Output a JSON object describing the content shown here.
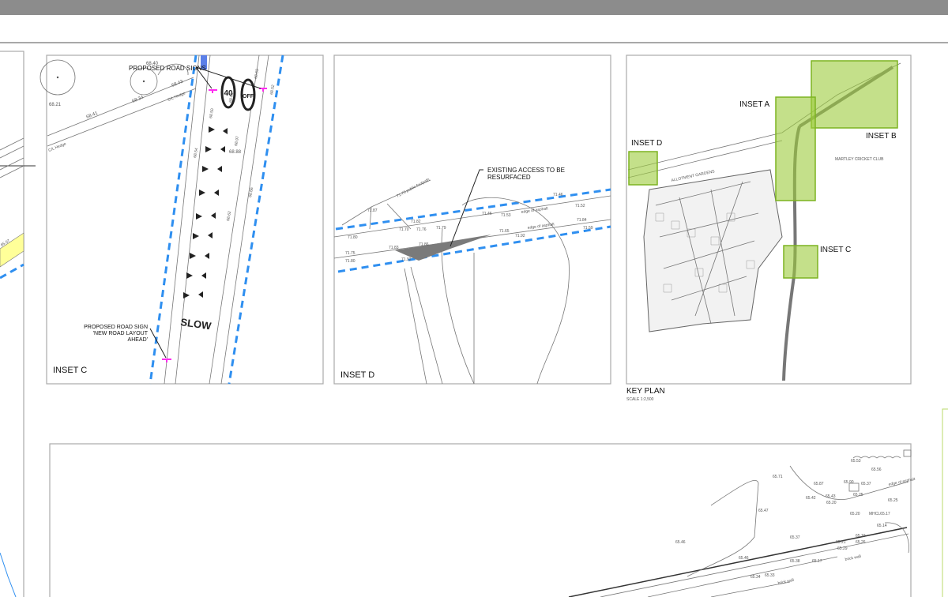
{
  "inset_c": {
    "title": "INSET C",
    "callout_signs": "PROPOSED ROAD SIGNS",
    "callout_sign_1": "PROPOSED ROAD SIGN",
    "callout_sign_2": "'NEW ROAD LAYOUT",
    "callout_sign_3": "AHEAD'",
    "sign_40": "40",
    "sign_derestrict": "OFF",
    "road_marking": "SLOW",
    "hedge_1": "C/L Hedge",
    "hedge_2": "C/L Hedge",
    "levels": [
      "68.21",
      "68.41",
      "68.34",
      "68.43",
      "68.40",
      "68.61",
      "68.50",
      "68.63",
      "68.54",
      "68.88",
      "68.97",
      "68.66",
      "68.52",
      "68.62"
    ]
  },
  "inset_d": {
    "title": "INSET D",
    "callout_1": "EXISTING ACCESS TO BE",
    "callout_2": "RESURFACED",
    "footpath": "71.70 public footpath",
    "edge_1": "edge of asphalt",
    "edge_2": "edge of asphalt",
    "levels": [
      "71.87",
      "71.80",
      "71.92",
      "71.82",
      "71.70",
      "71.76",
      "71.79",
      "71.53",
      "71.46",
      "71.52",
      "71.84",
      "71.75",
      "71.83",
      "71.86",
      "71.80",
      "71.65",
      "71.92",
      "71.59",
      "71.46"
    ]
  },
  "key_plan": {
    "title": "KEY PLAN",
    "scale": "SCALE 1:2,500",
    "inset_a": "INSET A",
    "inset_b": "INSET B",
    "inset_c": "INSET C",
    "inset_d": "INSET D",
    "club": "MARTLEY CRICKET CLUB",
    "allotment": "ALLOTMENT GARDENS"
  },
  "bottom_plan": {
    "manhole": "MHCL65.17",
    "wall_1": "brick wall",
    "wall_2": "brick wall",
    "edge": "edge of asphalt",
    "levels": [
      "65.53",
      "65.56",
      "65.71",
      "65.87",
      "65.90",
      "65.37",
      "65.42",
      "65.43",
      "65.20",
      "65.25",
      "65.25",
      "65.20",
      "65.17",
      "65.14",
      "65.19",
      "65.21",
      "65.29",
      "65.26",
      "65.38",
      "65.34",
      "65.33",
      "65.46",
      "65.46",
      "65.37",
      "65.47"
    ]
  },
  "left_panel": {
    "level": "65.07"
  },
  "colors": {
    "inset_fill": "#9ccb3c",
    "boundary_blue": "#2f8ff0",
    "sign_magenta": "#ff2cf0"
  }
}
